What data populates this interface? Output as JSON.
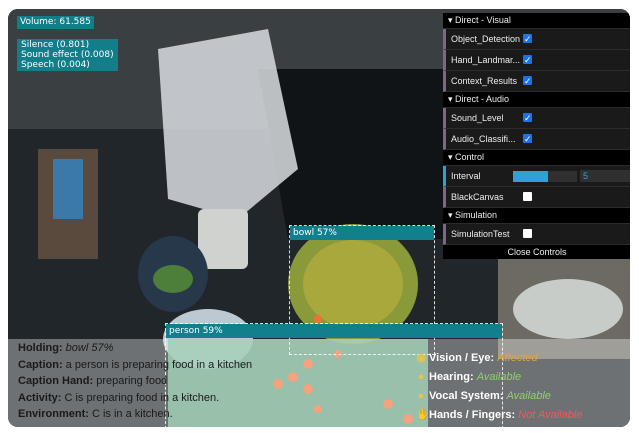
{
  "volume": "Volume: 61.585",
  "audio_classes": [
    "Silence (0.801)",
    "Sound effect (0.008)",
    "Speech (0.004)"
  ],
  "detections": [
    {
      "label": "bowl 57%"
    },
    {
      "label": "person 59%"
    }
  ],
  "gui": {
    "sections": [
      {
        "title": "Direct - Visual",
        "rows": [
          {
            "label": "Object_Detection",
            "checked": true
          },
          {
            "label": "Hand_Landmar...",
            "checked": true
          },
          {
            "label": "Context_Results",
            "checked": true
          }
        ]
      },
      {
        "title": "Direct - Audio",
        "rows": [
          {
            "label": "Sound_Level",
            "checked": true
          },
          {
            "label": "Audio_Classifi...",
            "checked": true
          }
        ]
      },
      {
        "title": "Control",
        "interval_label": "Interval",
        "interval_value": "5",
        "interval_fraction": 0.55,
        "blackcanvas_label": "BlackCanvas",
        "blackcanvas_checked": false
      },
      {
        "title": "Simulation",
        "rows": [
          {
            "label": "SimulationTest",
            "checked": false
          }
        ]
      }
    ],
    "close_label": "Close Controls"
  },
  "info": {
    "holding_label": "Holding:",
    "holding_value": "bowl 57%",
    "caption_label": "Caption:",
    "caption_value": "a person is preparing food in a kitchen",
    "caption_hand_label": "Caption Hand:",
    "caption_hand_value": "preparing food",
    "activity_label": "Activity:",
    "activity_value": "C is preparing food in a kitchen.",
    "environment_label": "Environment:",
    "environment_value": "C is in a kitchen."
  },
  "status": [
    {
      "label": "Vision / Eye:",
      "value": "Affected",
      "color": "#e6a23c",
      "icon": "eye-icon"
    },
    {
      "label": "Hearing:",
      "value": "Available",
      "color": "#8fd16a",
      "icon": "ear-icon"
    },
    {
      "label": "Vocal System:",
      "value": "Available",
      "color": "#8fd16a",
      "icon": "mouth-icon"
    },
    {
      "label": "Hands / Fingers:",
      "value": "Not Available",
      "color": "#f05a5a",
      "icon": "hand-icon"
    }
  ]
}
